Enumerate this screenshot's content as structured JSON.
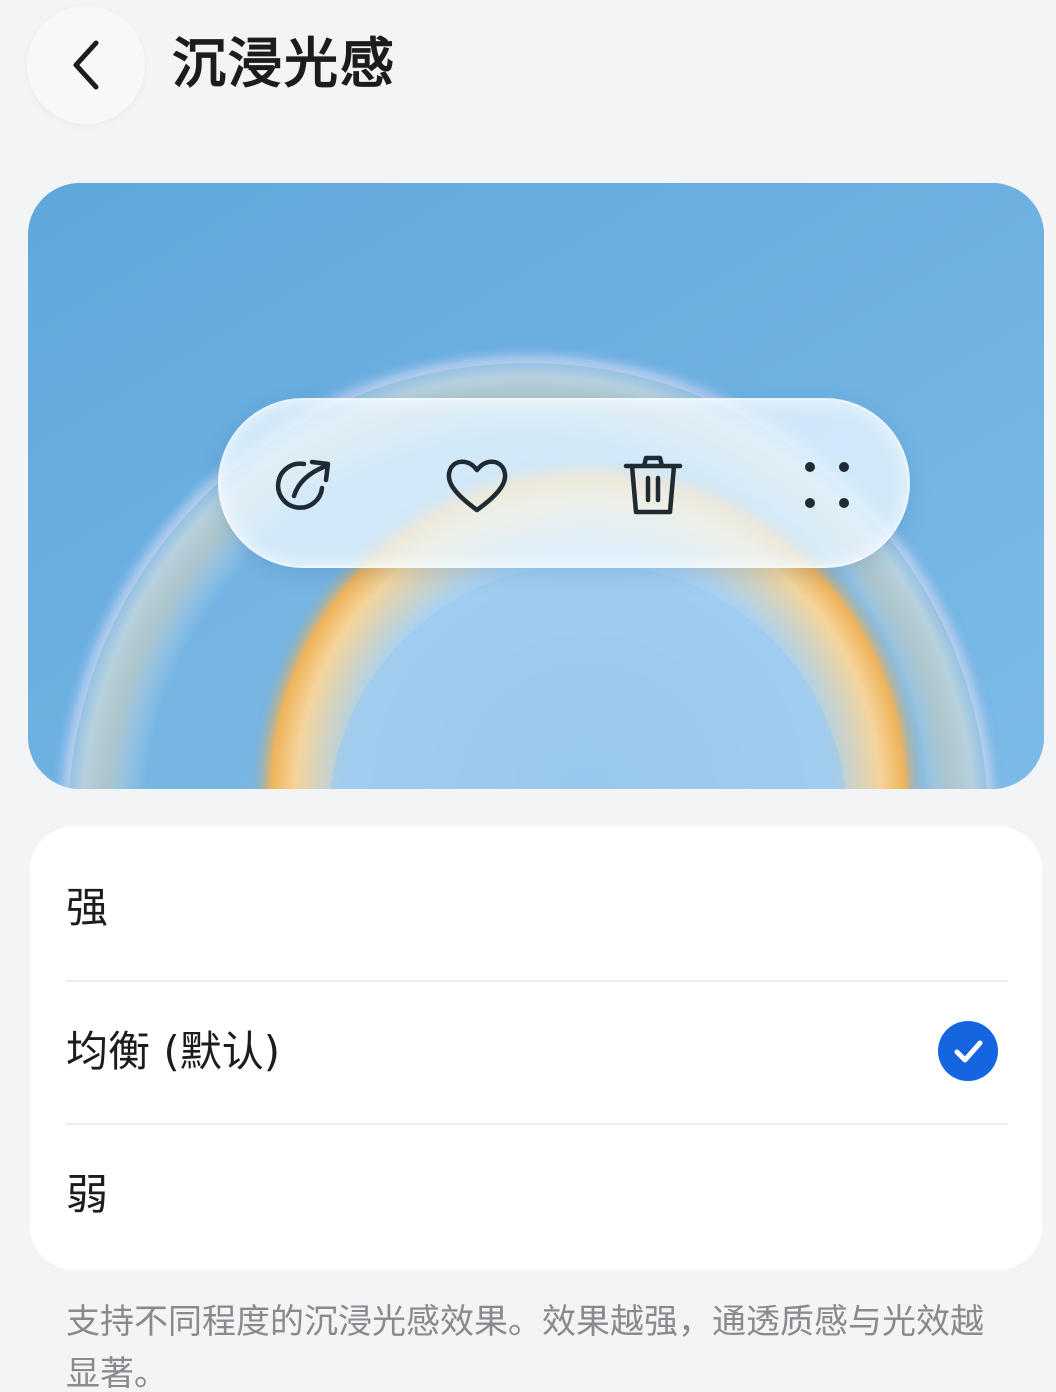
{
  "header": {
    "title": "沉浸光感",
    "back_icon": "chevron-left-icon"
  },
  "preview": {
    "toolbar_icons": [
      "share-icon",
      "heart-icon",
      "trash-icon",
      "more-dots-icon"
    ]
  },
  "options": [
    {
      "label": "强",
      "selected": false
    },
    {
      "label": "均衡 (默认)",
      "selected": true
    },
    {
      "label": "弱",
      "selected": false
    }
  ],
  "footnote": "支持不同程度的沉浸光感效果。效果越强，通透质感与光效越显著。",
  "colors": {
    "accent": "#1565e0",
    "background": "#f3f4f6",
    "preview_sky": "#6aaedf"
  }
}
